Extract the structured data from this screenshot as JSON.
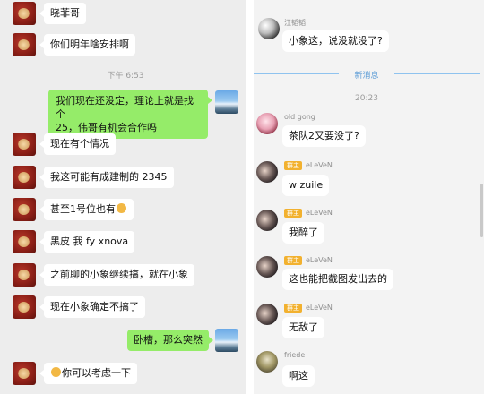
{
  "left_chat": {
    "time": "下午 6:53",
    "messages": [
      {
        "side": "in",
        "text": "晓菲哥"
      },
      {
        "side": "in",
        "text": "你们明年啥安排啊"
      },
      {
        "side": "out",
        "line1": "我们现在还没定，理论上就是找个",
        "line2": "25，伟哥有机会合作吗"
      },
      {
        "side": "in",
        "text": "现在有个情况"
      },
      {
        "side": "in",
        "text": "我这可能有成建制的 2345"
      },
      {
        "side": "in",
        "text": "甚至1号位也有"
      },
      {
        "side": "in",
        "text": "黑皮 我 fy xnova"
      },
      {
        "side": "in",
        "text": "之前聊的小象继续搞，就在小象"
      },
      {
        "side": "in",
        "text": "现在小象确定不搞了"
      },
      {
        "side": "out",
        "text": "卧槽，那么突然"
      },
      {
        "side": "in",
        "text": "你可以考虑一下"
      }
    ]
  },
  "right_chat": {
    "first": {
      "sender": "江韬韬",
      "text": "小象这，说没就没了?"
    },
    "new_messages_label": "新消息",
    "time": "20:23",
    "badge": "群主",
    "messages": [
      {
        "sender": "old gong",
        "text": "茶队2又要没了?"
      },
      {
        "sender": "eLeVeN",
        "text": "w zuile"
      },
      {
        "sender": "eLeVeN",
        "text": "我醉了"
      },
      {
        "sender": "eLeVeN",
        "text": "这也能把截图发出去的"
      },
      {
        "sender": "eLeVeN",
        "text": "无敌了"
      },
      {
        "sender": "friede",
        "text": "啊这"
      }
    ]
  }
}
